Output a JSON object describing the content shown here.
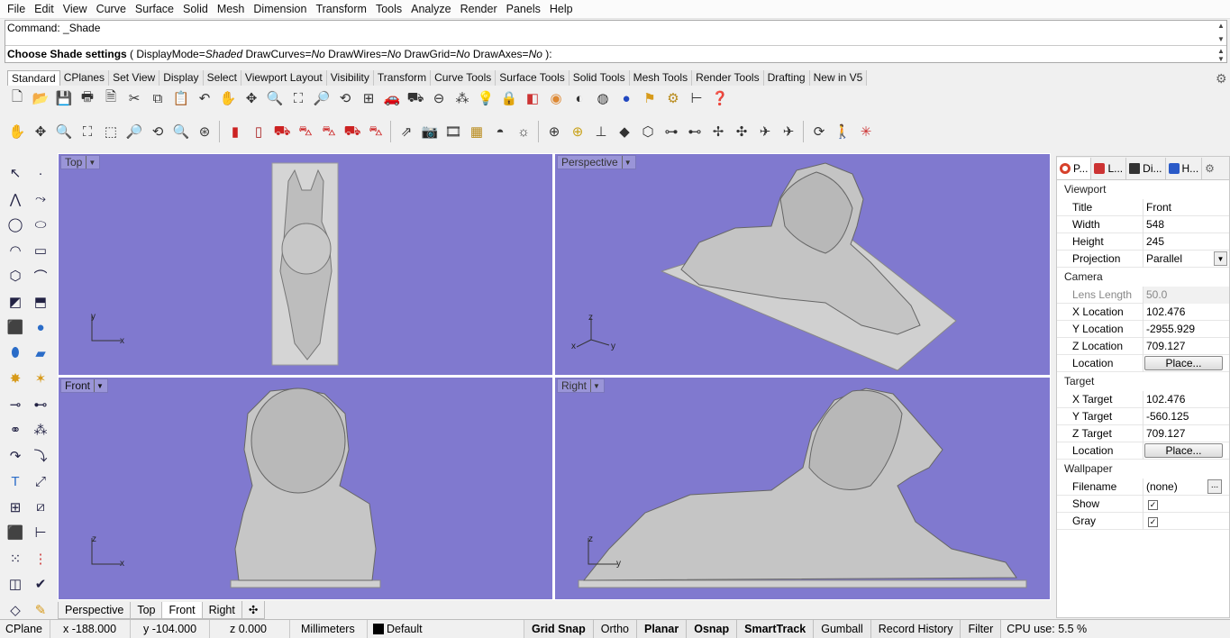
{
  "menu": [
    "File",
    "Edit",
    "View",
    "Curve",
    "Surface",
    "Solid",
    "Mesh",
    "Dimension",
    "Transform",
    "Tools",
    "Analyze",
    "Render",
    "Panels",
    "Help"
  ],
  "command": {
    "history": "Command: _Shade",
    "prompt_bold": "Choose Shade settings",
    "prompt_rest": " ( DisplayMode=",
    "displaymode": "Shaded",
    "opt1": " DrawCurves=",
    "v1": "No",
    "opt2": " DrawWires=",
    "v2": "No",
    "opt3": " DrawGrid=",
    "v3": "No",
    "opt4": " DrawAxes=",
    "v4": "No",
    "end": " ):"
  },
  "toolbar_tabs": [
    "Standard",
    "CPlanes",
    "Set View",
    "Display",
    "Select",
    "Viewport Layout",
    "Visibility",
    "Transform",
    "Curve Tools",
    "Surface Tools",
    "Solid Tools",
    "Mesh Tools",
    "Render Tools",
    "Drafting",
    "New in V5"
  ],
  "viewports": {
    "top": {
      "title": "Top",
      "ax1": "y",
      "ax2": "x"
    },
    "perspective": {
      "title": "Perspective",
      "ax1": "z",
      "ax2": "y",
      "ax3": "x"
    },
    "front": {
      "title": "Front",
      "ax1": "z",
      "ax2": "x"
    },
    "right": {
      "title": "Right",
      "ax1": "z",
      "ax2": "y"
    }
  },
  "viewport_tabs": [
    "Perspective",
    "Top",
    "Front",
    "Right"
  ],
  "panel": {
    "tabs": [
      "P...",
      "L...",
      "Di...",
      "H..."
    ],
    "viewport_section": "Viewport",
    "title_label": "Title",
    "title_value": "Front",
    "width_label": "Width",
    "width_value": "548",
    "height_label": "Height",
    "height_value": "245",
    "projection_label": "Projection",
    "projection_value": "Parallel",
    "camera_section": "Camera",
    "lens_label": "Lens Length",
    "lens_value": "50.0",
    "xloc_label": "X Location",
    "xloc_value": "102.476",
    "yloc_label": "Y Location",
    "yloc_value": "-2955.929",
    "zloc_label": "Z Location",
    "zloc_value": "709.127",
    "loc_label": "Location",
    "place_btn": "Place...",
    "target_section": "Target",
    "xt_label": "X Target",
    "xt_value": "102.476",
    "yt_label": "Y Target",
    "yt_value": "-560.125",
    "zt_label": "Z Target",
    "zt_value": "709.127",
    "tloc_label": "Location",
    "tplace_btn": "Place...",
    "wallpaper_section": "Wallpaper",
    "filename_label": "Filename",
    "filename_value": "(none)",
    "browse_btn": "...",
    "show_label": "Show",
    "gray_label": "Gray"
  },
  "status": {
    "cplane": "CPlane",
    "x": "x -188.000",
    "y": "y -104.000",
    "z": "z 0.000",
    "units": "Millimeters",
    "layer": "Default",
    "panes": [
      "Grid Snap",
      "Ortho",
      "Planar",
      "Osnap",
      "SmartTrack",
      "Gumball",
      "Record History",
      "Filter"
    ],
    "cpu": "CPU use: 5.5 %"
  },
  "colors": {
    "viewport_bg": "#8079cf",
    "model": "#c8c8c8"
  }
}
